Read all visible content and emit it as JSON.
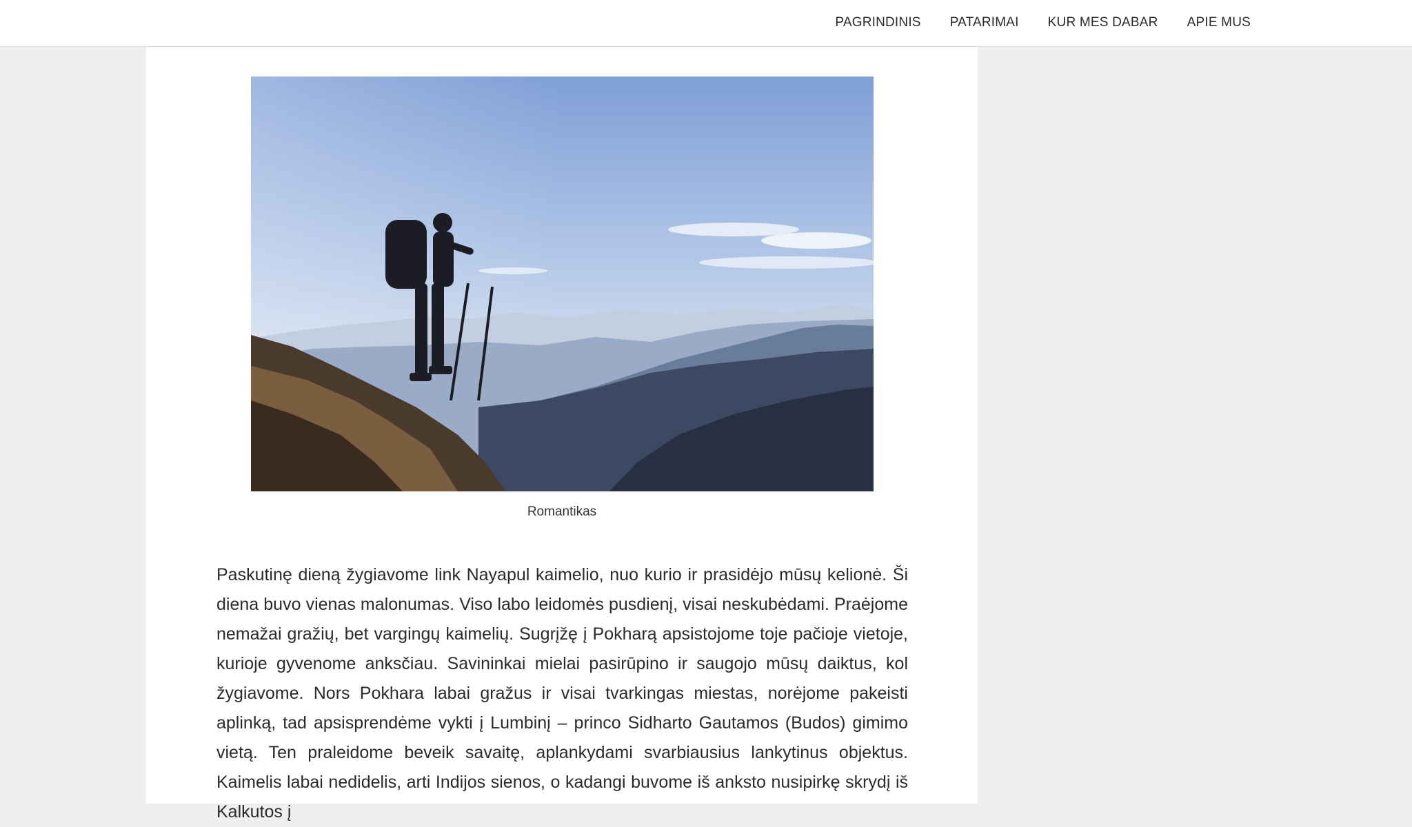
{
  "nav": {
    "items": [
      {
        "label": "PAGRINDINIS"
      },
      {
        "label": "PATARIMAI"
      },
      {
        "label": "KUR MES DABAR"
      },
      {
        "label": "APIE MUS"
      }
    ]
  },
  "article": {
    "figure": {
      "caption": "Romantikas"
    },
    "paragraph": "Paskutinę dieną žygiavome link Nayapul kaimelio, nuo kurio ir prasidėjo mūsų kelionė. Ši diena buvo vienas malonumas. Viso labo leidomės pusdienį, visai neskubėdami. Praėjome nemažai gražių, bet vargingų kaimelių. Sugrįžę į Pokharą apsistojome toje pačioje vietoje, kurioje gyvenome anksčiau. Savininkai mielai pasirūpino ir saugojo mūsų daiktus, kol žygiavome. Nors Pokhara labai gražus ir visai tvarkingas miestas, norėjome pakeisti aplinką, tad apsisprendėme vykti į Lumbinį – princo Sidharto Gautamos (Budos) gimimo vietą. Ten praleidome beveik savaitę, aplankydami svarbiausius lankytinus objektus. Kaimelis labai nedidelis, arti Indijos sienos, o kadangi buvome iš anksto nusipirkę skrydį iš Kalkutos į"
  },
  "colors": {
    "page_background": "#eeeff1",
    "header_background": "#ffffff",
    "content_background": "#ffffff",
    "text": "#2b2b2b"
  }
}
